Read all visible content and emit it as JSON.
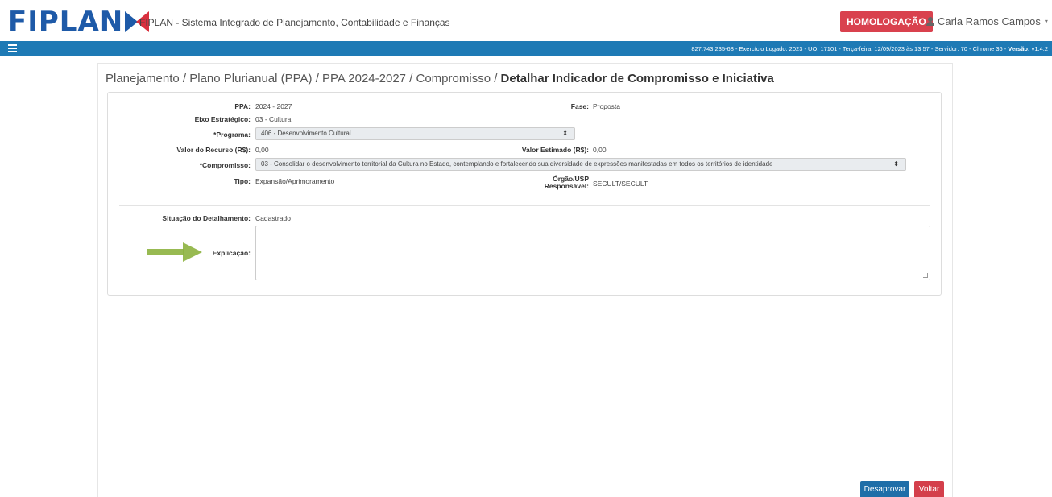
{
  "header": {
    "logo_text": "FIPLAN",
    "app_title": "FIPLAN - Sistema Integrado de Planejamento, Contabilidade e Finanças",
    "environment_badge": "HOMOLOGAÇÃO",
    "user_name": "Carla Ramos Campos",
    "user_caret": "▾"
  },
  "status_bar": {
    "info": "827.743.235-68 - Exercício Logado: 2023 - UO: 17101 - Terça-feira, 12/09/2023 às 13:57 - Servidor: 70 - Chrome 36 - ",
    "version_label": "Versão:",
    "version_value": "v1.4.2"
  },
  "breadcrumb": {
    "path": "Planejamento / Plano Plurianual (PPA) / PPA 2024-2027 / Compromisso / ",
    "current": "Detalhar Indicador de Compromisso e Iniciativa"
  },
  "form": {
    "ppa": {
      "label": "PPA:",
      "value": "2024 - 2027"
    },
    "fase": {
      "label": "Fase:",
      "value": "Proposta"
    },
    "eixo": {
      "label": "Eixo Estratégico:",
      "value": "03 - Cultura"
    },
    "programa": {
      "label": "*Programa:",
      "value": "406 - Desenvolvimento Cultural"
    },
    "valor_recurso": {
      "label": "Valor do Recurso (R$):",
      "value": "0,00"
    },
    "valor_estimado": {
      "label": "Valor Estimado (R$):",
      "value": "0,00"
    },
    "compromisso": {
      "label": "*Compromisso:",
      "value": "03 - Consolidar o desenvolvimento territorial da Cultura no Estado, contemplando e fortalecendo sua diversidade de expressões manifestadas em todos os territórios de identidade"
    },
    "tipo": {
      "label": "Tipo:",
      "value": "Expansão/Aprimoramento"
    },
    "orgao": {
      "label_line1": "Órgão/USP",
      "label_line2": "Responsável:",
      "value": "SECULT/SECULT"
    },
    "situacao": {
      "label": "Situação do Detalhamento:",
      "value": "Cadastrado"
    },
    "explicacao": {
      "label": "Explicação:",
      "value": ""
    },
    "select_arrows": "⬍"
  },
  "buttons": {
    "desaprovar": "Desaprovar",
    "voltar": "Voltar"
  },
  "colors": {
    "brand_blue": "#1e5aa8",
    "status_bar": "#1e7ab5",
    "badge_red": "#d9414e",
    "primary": "#1f6ea8",
    "danger": "#d43f4b",
    "annotation_arrow": "#8db33f"
  }
}
